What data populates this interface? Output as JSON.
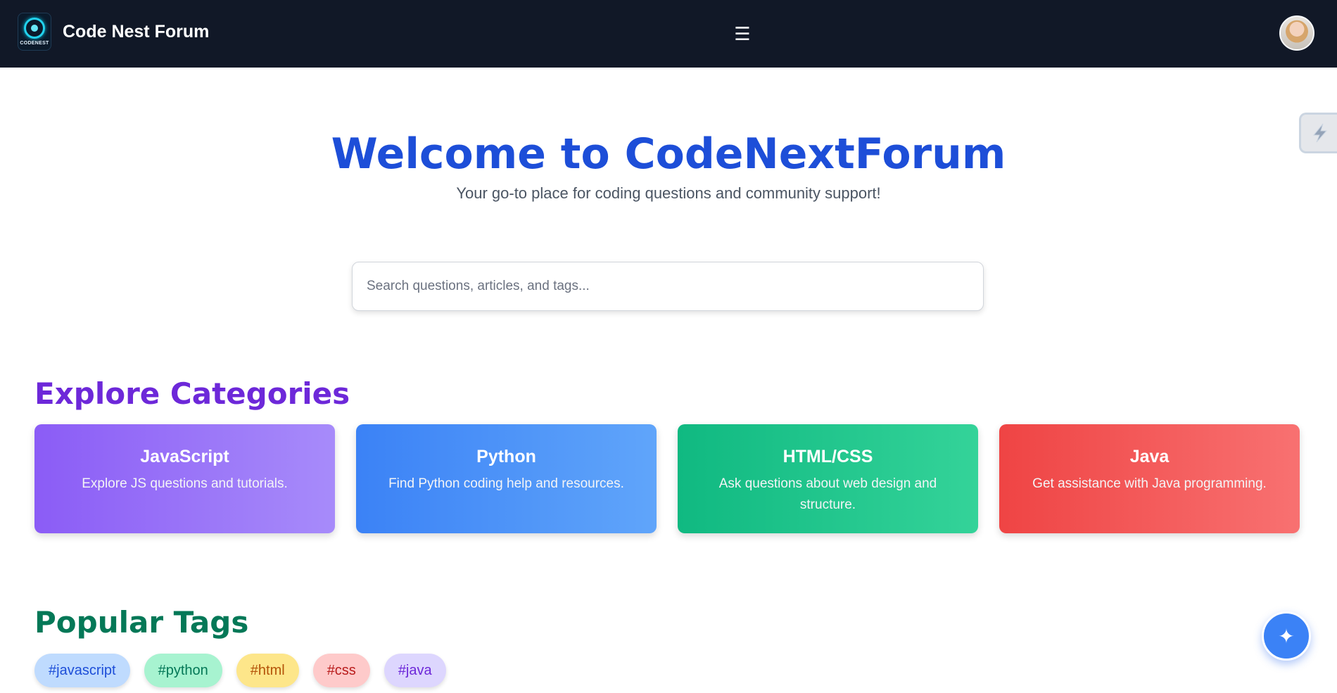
{
  "header": {
    "logo_text": "CODENEST",
    "brand_name": "Code Nest Forum",
    "menu_icon": "☰",
    "avatar_icon": "user-avatar"
  },
  "side_tab": {
    "icon": "lightning-icon"
  },
  "hero": {
    "title": "Welcome to CodeNextForum",
    "subtitle": "Your go-to place for coding questions and community support!"
  },
  "search": {
    "placeholder": "Search questions, articles, and tags...",
    "value": ""
  },
  "categories": {
    "title": "Explore Categories",
    "items": [
      {
        "name": "JavaScript",
        "description": "Explore JS questions and tutorials.",
        "color": "#8b5cf6"
      },
      {
        "name": "Python",
        "description": "Find Python coding help and resources.",
        "color": "#3b82f6"
      },
      {
        "name": "HTML/CSS",
        "description": "Ask questions about web design and structure.",
        "color": "#10b981"
      },
      {
        "name": "Java",
        "description": "Get assistance with Java programming.",
        "color": "#ef4444"
      }
    ]
  },
  "tags": {
    "title": "Popular Tags",
    "items": [
      {
        "label": "#javascript",
        "bg": "#bfdbfe",
        "fg": "#1d4ed8"
      },
      {
        "label": "#python",
        "bg": "#a7f3d0",
        "fg": "#047857"
      },
      {
        "label": "#html",
        "bg": "#fde68a",
        "fg": "#b45309"
      },
      {
        "label": "#css",
        "bg": "#fecaca",
        "fg": "#b91c1c"
      },
      {
        "label": "#java",
        "bg": "#ddd6fe",
        "fg": "#6d28d9"
      }
    ]
  },
  "fab": {
    "icon": "✦"
  },
  "colors": {
    "navbar": "#111827",
    "hero_title": "#1d4ed8",
    "categories_title": "#6d28d9",
    "tags_title": "#047857",
    "fab": "#3b82f6"
  }
}
